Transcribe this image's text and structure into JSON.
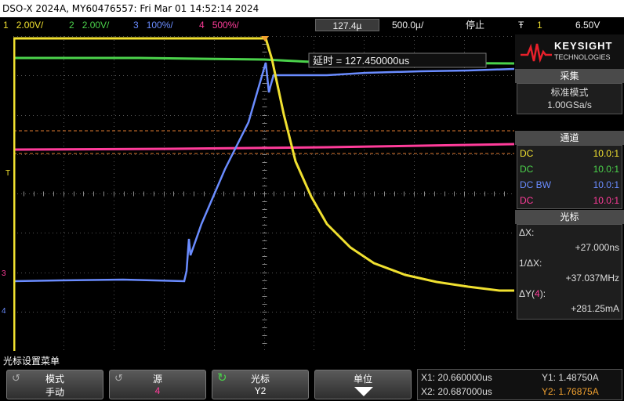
{
  "titlebar": {
    "text": "DSO-X 2024A, MY60476557: Fri Mar 01 14:52:14 2024"
  },
  "status": {
    "channels": [
      {
        "num": "1",
        "scale": "2.00V/",
        "color": "#f0e030"
      },
      {
        "num": "2",
        "scale": "2.00V/",
        "color": "#4bd24b"
      },
      {
        "num": "3",
        "scale": "100%/",
        "color": "#6a8cff"
      },
      {
        "num": "4",
        "scale": "500%/",
        "color": "#ff3c9a"
      }
    ],
    "timebase": "127.4µ",
    "timescale": "500.0µ/",
    "run_state": "停止",
    "trigger_icon": "Ŧ",
    "trigger_source": "1",
    "trigger_level": "6.50V"
  },
  "screen": {
    "delay_label": "延时 = 127.450000us",
    "trigger_marker": "T",
    "ground_markers": [
      "3",
      "4"
    ]
  },
  "panel": {
    "brand": "KEYSIGHT",
    "brand_sub": "TECHNOLOGIES",
    "acq_header": "采集",
    "acq_mode": "标准模式",
    "acq_rate": "1.00GSa/s",
    "chan_header": "通道",
    "channels": [
      {
        "coupling": "DC",
        "probe": "10.0:1",
        "color": "#f0e030"
      },
      {
        "coupling": "DC",
        "probe": "10.0:1",
        "color": "#4bd24b"
      },
      {
        "coupling": "DC BW",
        "probe": "10.0:1",
        "color": "#6a8cff"
      },
      {
        "coupling": "DC",
        "probe": "10.0:1",
        "color": "#ff3c9a"
      }
    ],
    "cursor_header": "光标",
    "dx_label": "ΔX:",
    "dx_value": "+27.000ns",
    "inv_dx_label": "1/ΔX:",
    "inv_dx_value": "+37.037MHz",
    "dy_label": "ΔY(",
    "dy_channel": "4",
    "dy_label_end": "):",
    "dy_value": "+281.25mA"
  },
  "softkeys": {
    "menu_title": "光标设置菜单",
    "mode": {
      "title": "模式",
      "value": "手动"
    },
    "source": {
      "title": "源",
      "value": "4"
    },
    "cursors": {
      "title": "光标",
      "value": "Y2"
    },
    "units": {
      "title": "单位"
    }
  },
  "readout": {
    "x1": "X1: 20.660000us",
    "x2": "X2: 20.687000us",
    "y1": "Y1: 1.48750A",
    "y2": "Y2: 1.76875A"
  }
}
